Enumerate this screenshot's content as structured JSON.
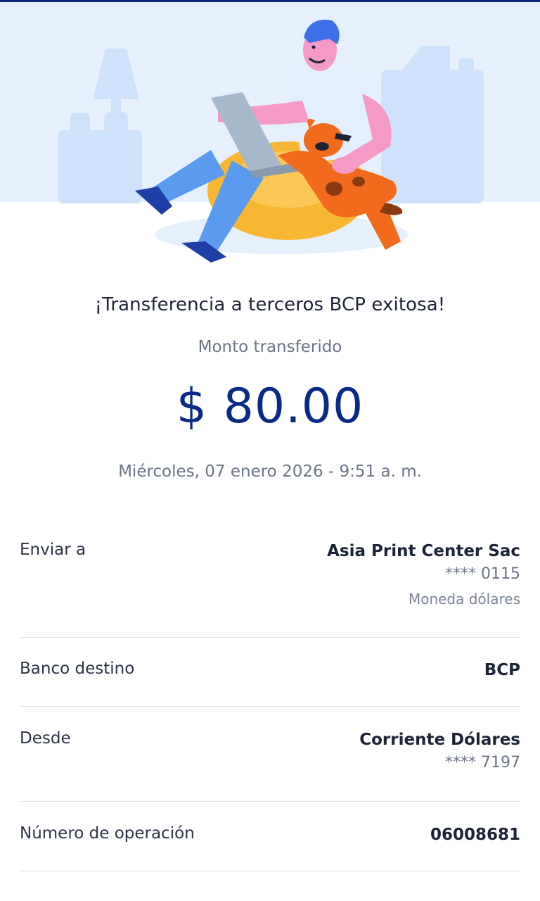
{
  "header": {
    "title": "¡Transferencia a terceros BCP exitosa!",
    "amount_label": "Monto transferido",
    "amount": "$ 80.00",
    "datetime": "Miércoles, 07 enero 2026 - 9:51 a. m."
  },
  "details": {
    "send_to": {
      "label": "Enviar a",
      "name": "Asia Print Center Sac",
      "account": "**** 0115",
      "currency": "Moneda dólares"
    },
    "bank": {
      "label": "Banco destino",
      "value": "BCP"
    },
    "from": {
      "label": "Desde",
      "account_type": "Corriente Dólares",
      "account": "**** 7197"
    },
    "operation": {
      "label": "Número de operación",
      "value": "06008681"
    }
  },
  "colors": {
    "accent": "#0a2a8a",
    "title_text": "#1d2438",
    "muted_text": "#6a7587",
    "hero_bg": "#e6f0fd",
    "divider": "#dfe3ea"
  }
}
